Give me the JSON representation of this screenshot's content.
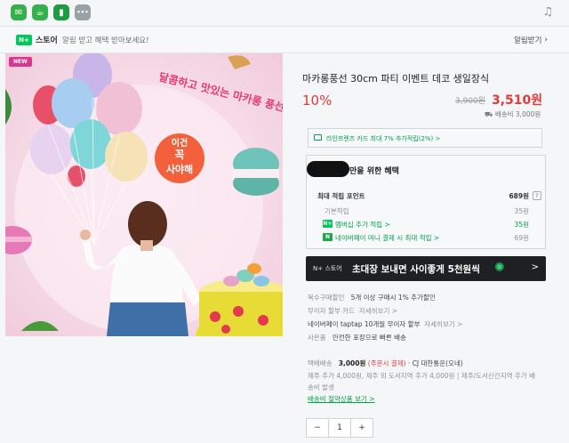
{
  "topbar": {
    "apps": [
      {
        "name": "chat-app-icon",
        "color": "#35b04a",
        "glyph": "✉"
      },
      {
        "name": "cafe-app-icon",
        "color": "#35b04a",
        "glyph": "☕"
      },
      {
        "name": "bookmark-app-icon",
        "color": "#1f9c43",
        "glyph": "▮"
      },
      {
        "name": "more-apps-icon",
        "color": "#9aa1a7",
        "glyph": "•••"
      }
    ]
  },
  "notice": {
    "badge": "N+",
    "store": "스토어",
    "text": "알림 받고 혜택 받아보세요!",
    "alarm_button": "알림받기"
  },
  "gallery": {
    "new_badge": "NEW",
    "headline": "달콤하고 맛있는 마카롱 풍선",
    "sticker_line1": "이건",
    "sticker_line2": "꼭",
    "sticker_line3": "사야해"
  },
  "product": {
    "title": "마카롱풍선 30cm 파티 이벤트 데코 생일장식",
    "discount": "10%",
    "original_price": "3,900원",
    "sale_price": "3,510원",
    "shipping": "배송비 3,000원"
  },
  "card_promo": {
    "text": "라인프렌즈 카드 최대 7% 추가적립(2%) >"
  },
  "benefit": {
    "title": "만을 위한 혜택",
    "points_label": "최대 적립 포인트",
    "points_value": "689원",
    "help": "?",
    "rows": [
      {
        "label": "기본적립",
        "value": "35원",
        "style": "muted"
      },
      {
        "label": "멤버십 추가 적립 >",
        "value": "35원",
        "style": "link",
        "badge": "N+"
      },
      {
        "label": "네이버페이 머니 결제 시 최대 적립 >",
        "value": "69원",
        "style": "link",
        "badge": "N"
      }
    ]
  },
  "banner": {
    "logo": "N+ 스토어",
    "text": "초대장 보내면 사이좋게 5천원씩",
    "arrow": ">"
  },
  "details": {
    "multi_label": "복수구매할인",
    "multi_value": "5개 이상 구매시 1% 추가할인",
    "card_label": "무이자 할부 카드",
    "card_link": "자세히보기 >",
    "taptap": "네이버페이 taptap 10개월 무이자 할부",
    "taptap_link": "자세히보기 >",
    "gift_label": "사은품",
    "gift_value": "안전한 포장으로 빠른 배송",
    "delivery_label": "택배배송",
    "delivery_fee": "3,000원",
    "delivery_cond": "(주문시 결제)",
    "delivery_carrier": "· CJ 대한통운(오네)",
    "extra_fee_1": "제주 추가 4,000원, 제주 외 도서지역 추가 4,000원 | 제주/도서산간지역 추가 배",
    "extra_fee_2": "송비 발생",
    "delivery_link": "배송비 절약상품 보기 >"
  },
  "quantity": {
    "minus": "−",
    "value": "1",
    "plus": "+"
  }
}
